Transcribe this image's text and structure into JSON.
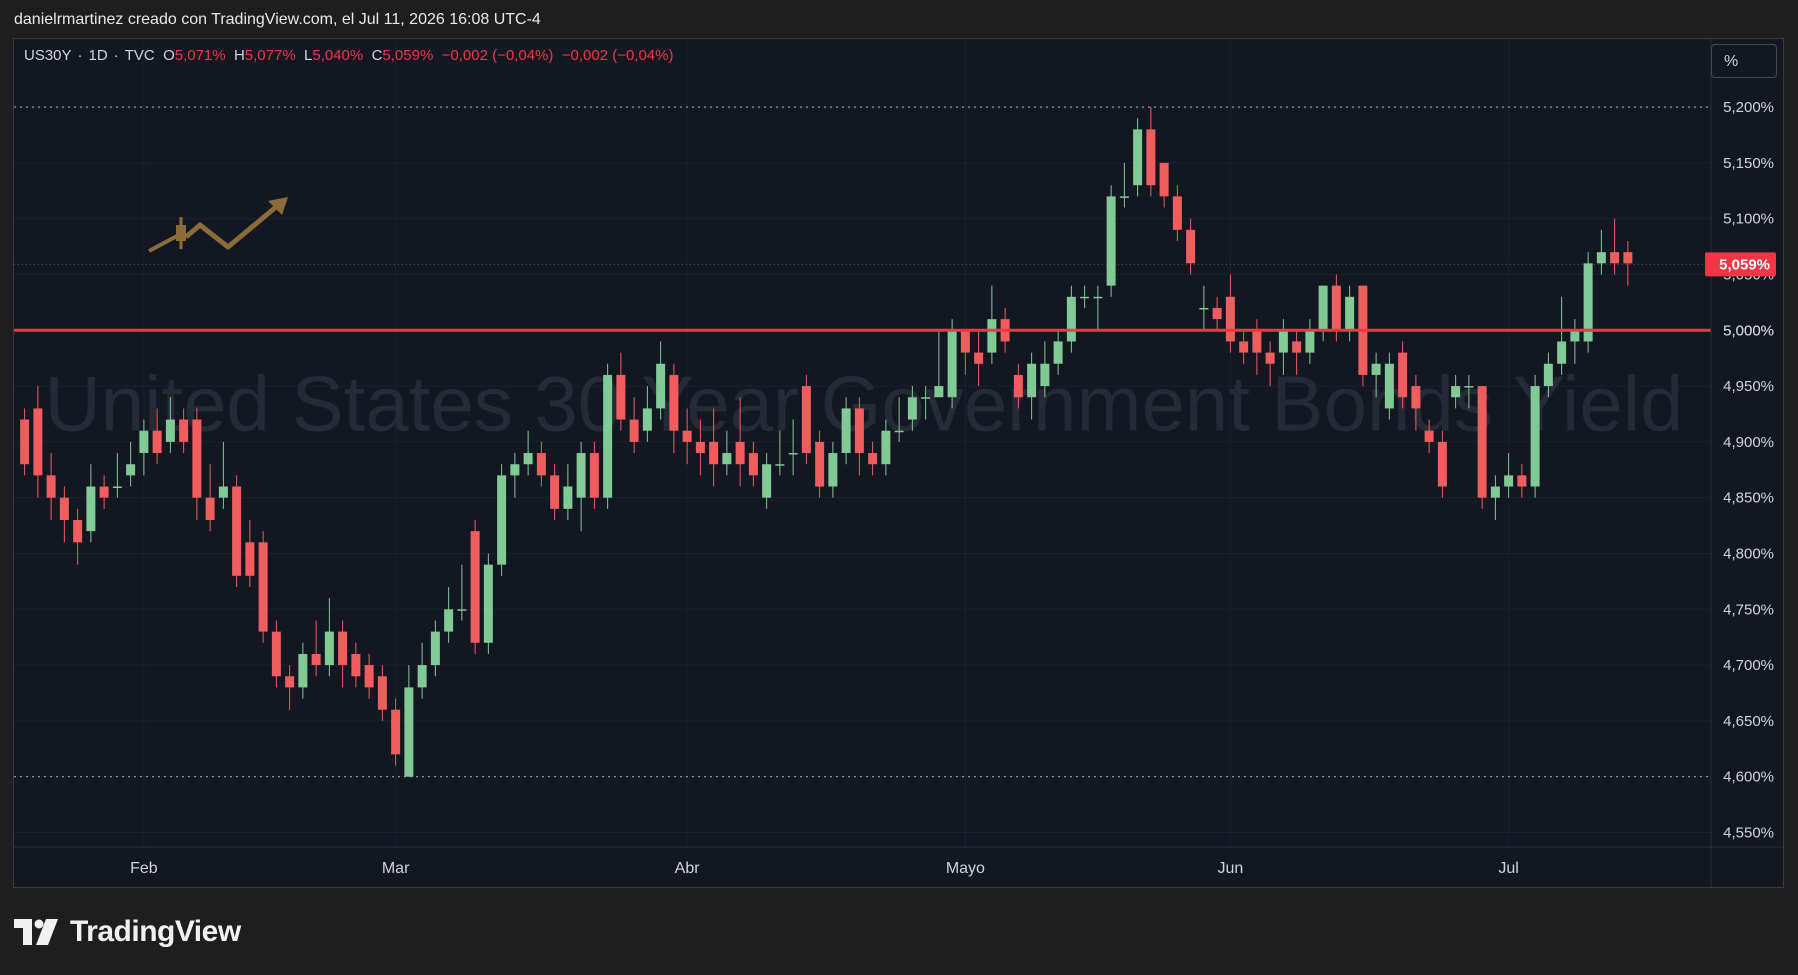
{
  "header": {
    "attribution": "danielrmartinez creado con TradingView.com, el Jul 11, 2026 16:08 UTC-4"
  },
  "legend": {
    "symbol": "US30Y",
    "interval": "1D",
    "source": "TVC",
    "open_label": "O",
    "open": "5,071%",
    "high_label": "H",
    "high": "5,077%",
    "low_label": "L",
    "low": "5,040%",
    "close_label": "C",
    "close": "5,059%",
    "change": "−0,002 (−0,04%)",
    "change2": "−0,002 (−0,04%)"
  },
  "unit_button": "%",
  "watermark": "United States 30 Year Government Bonds Yield",
  "footer": {
    "brand": "TradingView"
  },
  "colors": {
    "background": "#131722",
    "up": "#81c995",
    "down": "#f05d5e",
    "support_line": "#f23645",
    "last_price_tag": "#f23645",
    "text": "#d1d4dc"
  },
  "chart_data": {
    "type": "candlestick",
    "y_unit": "%",
    "y_ticks": [
      "5,200%",
      "5,150%",
      "5,100%",
      "5,050%",
      "5,000%",
      "4,950%",
      "4,900%",
      "4,850%",
      "4,800%",
      "4,750%",
      "4,700%",
      "4,650%",
      "4,600%",
      "4,550%"
    ],
    "y_tick_values": [
      5.2,
      5.15,
      5.1,
      5.05,
      5.0,
      4.95,
      4.9,
      4.85,
      4.8,
      4.75,
      4.7,
      4.65,
      4.6,
      4.55
    ],
    "ylim": [
      4.537,
      5.261
    ],
    "x_labels": [
      {
        "label": "Feb",
        "index": 9
      },
      {
        "label": "Mar",
        "index": 28
      },
      {
        "label": "Abr",
        "index": 50
      },
      {
        "label": "Mayo",
        "index": 71
      },
      {
        "label": "Jun",
        "index": 91
      },
      {
        "label": "Jul",
        "index": 112
      }
    ],
    "n_slots": 135,
    "horizontal_line": {
      "value": 5.0,
      "label": "5,000%"
    },
    "dotted_lines": [
      5.2,
      4.6
    ],
    "last_price": {
      "value": 5.059,
      "label": "5,059%"
    },
    "candles": [
      [
        4.92,
        4.88,
        4.93,
        4.87
      ],
      [
        4.93,
        4.87,
        4.95,
        4.85
      ],
      [
        4.87,
        4.85,
        4.89,
        4.83
      ],
      [
        4.85,
        4.83,
        4.86,
        4.81
      ],
      [
        4.83,
        4.81,
        4.84,
        4.79
      ],
      [
        4.82,
        4.86,
        4.88,
        4.81
      ],
      [
        4.86,
        4.85,
        4.87,
        4.84
      ],
      [
        4.86,
        4.86,
        4.89,
        4.85
      ],
      [
        4.87,
        4.88,
        4.9,
        4.86
      ],
      [
        4.89,
        4.91,
        4.92,
        4.87
      ],
      [
        4.91,
        4.89,
        4.93,
        4.88
      ],
      [
        4.9,
        4.92,
        4.94,
        4.89
      ],
      [
        4.92,
        4.9,
        4.93,
        4.89
      ],
      [
        4.92,
        4.85,
        4.93,
        4.83
      ],
      [
        4.85,
        4.83,
        4.88,
        4.82
      ],
      [
        4.85,
        4.86,
        4.9,
        4.84
      ],
      [
        4.86,
        4.78,
        4.87,
        4.77
      ],
      [
        4.81,
        4.78,
        4.83,
        4.77
      ],
      [
        4.81,
        4.73,
        4.82,
        4.72
      ],
      [
        4.73,
        4.69,
        4.74,
        4.68
      ],
      [
        4.69,
        4.68,
        4.7,
        4.66
      ],
      [
        4.68,
        4.71,
        4.72,
        4.67
      ],
      [
        4.71,
        4.7,
        4.74,
        4.69
      ],
      [
        4.7,
        4.73,
        4.76,
        4.69
      ],
      [
        4.73,
        4.7,
        4.74,
        4.68
      ],
      [
        4.71,
        4.69,
        4.72,
        4.68
      ],
      [
        4.7,
        4.68,
        4.71,
        4.67
      ],
      [
        4.69,
        4.66,
        4.7,
        4.65
      ],
      [
        4.66,
        4.62,
        4.67,
        4.61
      ],
      [
        4.6,
        4.68,
        4.7,
        4.6
      ],
      [
        4.68,
        4.7,
        4.72,
        4.67
      ],
      [
        4.7,
        4.73,
        4.74,
        4.69
      ],
      [
        4.73,
        4.75,
        4.77,
        4.72
      ],
      [
        4.75,
        4.75,
        4.79,
        4.74
      ],
      [
        4.82,
        4.72,
        4.83,
        4.71
      ],
      [
        4.72,
        4.79,
        4.8,
        4.71
      ],
      [
        4.79,
        4.87,
        4.88,
        4.78
      ],
      [
        4.87,
        4.88,
        4.89,
        4.85
      ],
      [
        4.88,
        4.89,
        4.91,
        4.87
      ],
      [
        4.89,
        4.87,
        4.9,
        4.86
      ],
      [
        4.87,
        4.84,
        4.88,
        4.83
      ],
      [
        4.84,
        4.86,
        4.88,
        4.83
      ],
      [
        4.85,
        4.89,
        4.9,
        4.82
      ],
      [
        4.89,
        4.85,
        4.9,
        4.84
      ],
      [
        4.85,
        4.96,
        4.97,
        4.84
      ],
      [
        4.96,
        4.92,
        4.98,
        4.91
      ],
      [
        4.92,
        4.9,
        4.94,
        4.89
      ],
      [
        4.91,
        4.93,
        4.95,
        4.9
      ],
      [
        4.93,
        4.97,
        4.99,
        4.92
      ],
      [
        4.96,
        4.91,
        4.97,
        4.89
      ],
      [
        4.91,
        4.9,
        4.93,
        4.88
      ],
      [
        4.9,
        4.89,
        4.92,
        4.87
      ],
      [
        4.9,
        4.88,
        4.93,
        4.86
      ],
      [
        4.88,
        4.89,
        4.91,
        4.87
      ],
      [
        4.9,
        4.88,
        4.94,
        4.86
      ],
      [
        4.89,
        4.87,
        4.9,
        4.86
      ],
      [
        4.85,
        4.88,
        4.89,
        4.84
      ],
      [
        4.88,
        4.88,
        4.91,
        4.87
      ],
      [
        4.89,
        4.89,
        4.92,
        4.87
      ],
      [
        4.95,
        4.89,
        4.96,
        4.88
      ],
      [
        4.9,
        4.86,
        4.91,
        4.85
      ],
      [
        4.86,
        4.89,
        4.9,
        4.85
      ],
      [
        4.89,
        4.93,
        4.94,
        4.88
      ],
      [
        4.93,
        4.89,
        4.94,
        4.87
      ],
      [
        4.89,
        4.88,
        4.9,
        4.87
      ],
      [
        4.88,
        4.91,
        4.92,
        4.87
      ],
      [
        4.91,
        4.91,
        4.94,
        4.9
      ],
      [
        4.92,
        4.94,
        4.95,
        4.91
      ],
      [
        4.94,
        4.94,
        4.95,
        4.92
      ],
      [
        4.94,
        4.95,
        5.0,
        4.94
      ],
      [
        4.94,
        5.0,
        5.01,
        4.93
      ],
      [
        5.0,
        4.98,
        5.0,
        4.96
      ],
      [
        4.98,
        4.97,
        5.0,
        4.95
      ],
      [
        4.98,
        5.01,
        5.04,
        4.97
      ],
      [
        5.01,
        4.99,
        5.02,
        4.98
      ],
      [
        4.96,
        4.94,
        4.97,
        4.93
      ],
      [
        4.94,
        4.97,
        4.98,
        4.92
      ],
      [
        4.95,
        4.97,
        4.99,
        4.94
      ],
      [
        4.97,
        4.99,
        5.0,
        4.96
      ],
      [
        4.99,
        5.03,
        5.04,
        4.98
      ],
      [
        5.03,
        5.03,
        5.04,
        5.02
      ],
      [
        5.03,
        5.03,
        5.04,
        5.0
      ],
      [
        5.04,
        5.12,
        5.13,
        5.03
      ],
      [
        5.12,
        5.12,
        5.15,
        5.11
      ],
      [
        5.13,
        5.18,
        5.19,
        5.12
      ],
      [
        5.18,
        5.13,
        5.2,
        5.12
      ],
      [
        5.15,
        5.12,
        5.15,
        5.11
      ],
      [
        5.12,
        5.09,
        5.13,
        5.08
      ],
      [
        5.09,
        5.06,
        5.1,
        5.05
      ],
      [
        5.02,
        5.02,
        5.04,
        5.0
      ],
      [
        5.02,
        5.01,
        5.03,
        5.0
      ],
      [
        5.03,
        4.99,
        5.05,
        4.98
      ],
      [
        4.99,
        4.98,
        5.0,
        4.97
      ],
      [
        5.0,
        4.98,
        5.01,
        4.96
      ],
      [
        4.98,
        4.97,
        4.99,
        4.95
      ],
      [
        4.98,
        5.0,
        5.01,
        4.96
      ],
      [
        4.99,
        4.98,
        5.0,
        4.96
      ],
      [
        4.98,
        5.0,
        5.01,
        4.97
      ],
      [
        5.0,
        5.04,
        5.04,
        4.99
      ],
      [
        5.04,
        5.0,
        5.05,
        4.99
      ],
      [
        5.0,
        5.03,
        5.04,
        4.99
      ],
      [
        5.04,
        4.96,
        5.04,
        4.95
      ],
      [
        4.96,
        4.97,
        4.98,
        4.94
      ],
      [
        4.93,
        4.97,
        4.98,
        4.92
      ],
      [
        4.98,
        4.94,
        4.99,
        4.93
      ],
      [
        4.95,
        4.93,
        4.96,
        4.91
      ],
      [
        4.91,
        4.9,
        4.92,
        4.89
      ],
      [
        4.9,
        4.86,
        4.91,
        4.85
      ],
      [
        4.94,
        4.95,
        4.96,
        4.93
      ],
      [
        4.95,
        4.95,
        4.96,
        4.93
      ],
      [
        4.95,
        4.85,
        4.95,
        4.84
      ],
      [
        4.85,
        4.86,
        4.87,
        4.83
      ],
      [
        4.86,
        4.87,
        4.89,
        4.85
      ],
      [
        4.87,
        4.86,
        4.88,
        4.85
      ],
      [
        4.86,
        4.95,
        4.96,
        4.85
      ],
      [
        4.95,
        4.97,
        4.98,
        4.94
      ],
      [
        4.97,
        4.99,
        5.03,
        4.96
      ],
      [
        4.99,
        5.0,
        5.01,
        4.97
      ],
      [
        4.99,
        5.06,
        5.07,
        4.98
      ],
      [
        5.06,
        5.07,
        5.09,
        5.05
      ],
      [
        5.07,
        5.06,
        5.1,
        5.05
      ],
      [
        5.07,
        5.06,
        5.08,
        5.04
      ]
    ]
  }
}
